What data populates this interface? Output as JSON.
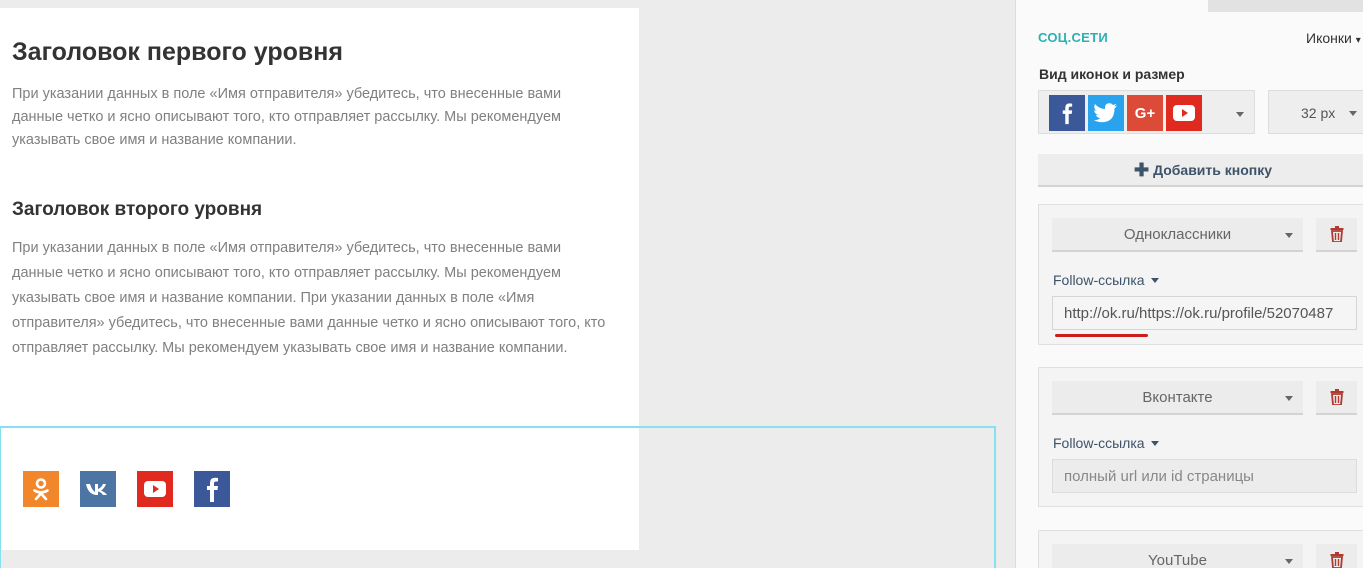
{
  "content": {
    "h1": "Заголовок первого уровня",
    "p1": "При указании данных в поле «Имя отправителя» убедитесь, что внесенные вами данные четко и ясно описывают того, кто отправляет рассылку. Мы рекомендуем указывать свое имя и название компании.",
    "h2": "Заголовок второго уровня",
    "p2": "При указании данных в поле «Имя отправителя» убедитесь, что внесенные вами данные четко и ясно описывают того, кто отправляет рассылку. Мы рекомендуем указывать свое имя и название компании. При указании данных в поле «Имя отправителя» убедитесь, что внесенные вами данные четко и ясно описывают того, кто отправляет рассылку. Мы рекомендуем указывать свое имя и название компании."
  },
  "social_block": {
    "icons": [
      {
        "name": "odnoklassniki",
        "color": "#f2862a"
      },
      {
        "name": "vkontakte",
        "color": "#4c75a3"
      },
      {
        "name": "youtube",
        "color": "#e02a20"
      },
      {
        "name": "facebook",
        "color": "#3b5998"
      }
    ]
  },
  "panel": {
    "section_title": "СОЦ.СЕТИ",
    "mode_label": "Иконки",
    "icons_label": "Вид иконок и размер",
    "icon_style_preview": [
      {
        "name": "facebook",
        "color": "#3b5998"
      },
      {
        "name": "twitter",
        "color": "#2aa3ef"
      },
      {
        "name": "google-plus",
        "color": "#dc4a38"
      },
      {
        "name": "youtube",
        "color": "#e02a20"
      }
    ],
    "size_value": "32 px",
    "add_button_label": "Добавить кнопку",
    "cards": [
      {
        "network": "Одноклассники",
        "follow_label": "Follow-ссылка",
        "url_value": "http://ok.ru/https://ok.ru/profile/52070487",
        "url_placeholder": ""
      },
      {
        "network": "Вконтакте",
        "follow_label": "Follow-ссылка",
        "url_value": "",
        "url_placeholder": "полный url или id страницы"
      },
      {
        "network": "YouTube"
      }
    ]
  },
  "colors": {
    "accent": "#2ab1b5",
    "link": "#3d5369",
    "danger": "#cc1b1b",
    "selection_border": "#87e0f0"
  }
}
